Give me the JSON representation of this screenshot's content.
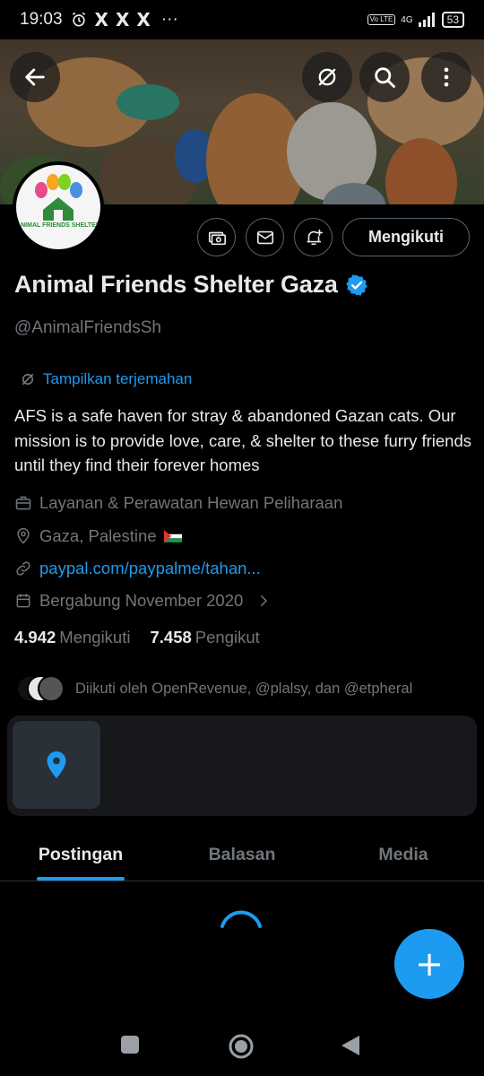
{
  "status": {
    "time": "19:03",
    "alarm_icon": "alarm-icon",
    "notif_icons": [
      "X",
      "X",
      "X"
    ],
    "more": "···",
    "volte": "Vo LTE",
    "network": "4G",
    "battery": "53"
  },
  "profile": {
    "name": "Animal Friends Shelter Gaza",
    "handle": "@AnimalFriendsSh",
    "avatar_text": "ANIMAL FRIENDS SHELTER",
    "follow_label": "Mengikuti",
    "translate_label": "Tampilkan terjemahan",
    "bio": "AFS is a safe haven for stray & abandoned Gazan cats. Our mission is to provide love, care, & shelter to these furry friends until they find their forever homes",
    "category": "Layanan & Perawatan Hewan Peliharaan",
    "location": "Gaza, Palestine",
    "link": "paypal.com/paypalme/tahan...",
    "joined": "Bergabung November 2020",
    "following_count": "4.942",
    "following_label": "Mengikuti",
    "followers_count": "7.458",
    "followers_label": "Pengikut",
    "followed_by": "Diikuti oleh OpenRevenue, @plalsy, dan @etpheral"
  },
  "tabs": [
    {
      "label": "Postingan",
      "active": true
    },
    {
      "label": "Balasan",
      "active": false
    },
    {
      "label": "Media",
      "active": false
    }
  ],
  "colors": {
    "accent": "#1d9bf0",
    "muted": "#71767b",
    "text": "#e7e9ea",
    "background": "#000000"
  }
}
